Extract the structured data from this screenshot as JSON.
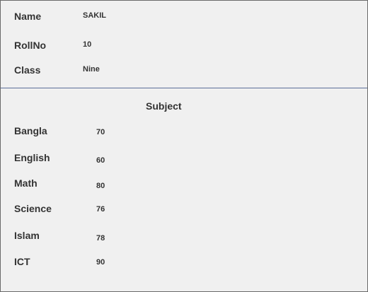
{
  "student": {
    "name_label": "Name",
    "name_value": "SAKIL",
    "roll_label": "RollNo",
    "roll_value": "10",
    "class_label": "Class",
    "class_value": "Nine"
  },
  "subjects": {
    "heading": "Subject",
    "rows": [
      {
        "label": "Bangla",
        "mark": "70"
      },
      {
        "label": "English",
        "mark": "60"
      },
      {
        "label": "Math",
        "mark": "80"
      },
      {
        "label": "Science",
        "mark": "76"
      },
      {
        "label": "Islam",
        "mark": "78"
      },
      {
        "label": "ICT",
        "mark": "90"
      }
    ]
  },
  "colors": {
    "background": "#f0f0f0",
    "divider": "#5a6e98",
    "text": "#333333"
  }
}
